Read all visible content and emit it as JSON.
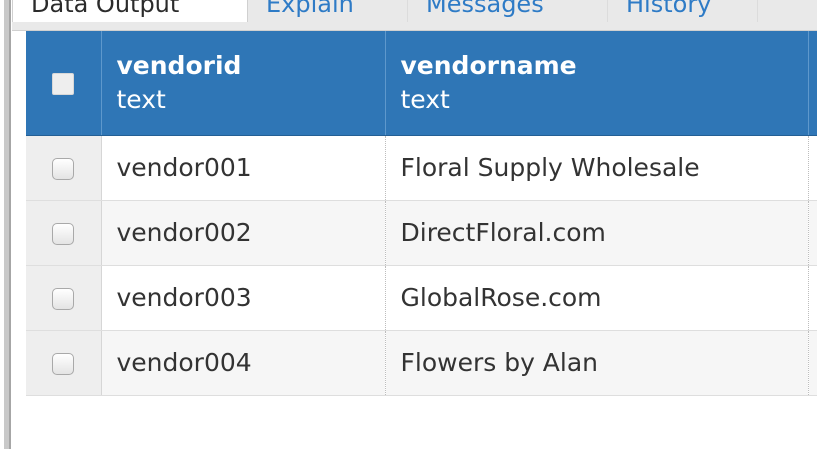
{
  "tabs": [
    {
      "label": "Data Output",
      "active": true
    },
    {
      "label": "Explain",
      "active": false
    },
    {
      "label": "Messages",
      "active": false
    },
    {
      "label": "History",
      "active": false
    }
  ],
  "grid": {
    "columns": [
      {
        "name": "vendorid",
        "type": "text"
      },
      {
        "name": "vendorname",
        "type": "text"
      }
    ],
    "rows": [
      {
        "vendorid": "vendor001",
        "vendorname": "Floral Supply Wholesale"
      },
      {
        "vendorid": "vendor002",
        "vendorname": "DirectFloral.com"
      },
      {
        "vendorid": "vendor003",
        "vendorname": "GlobalRose.com"
      },
      {
        "vendorid": "vendor004",
        "vendorname": "Flowers by Alan"
      }
    ]
  },
  "colors": {
    "header_bg": "#2f76b6",
    "tab_link": "#2e7bc6"
  }
}
